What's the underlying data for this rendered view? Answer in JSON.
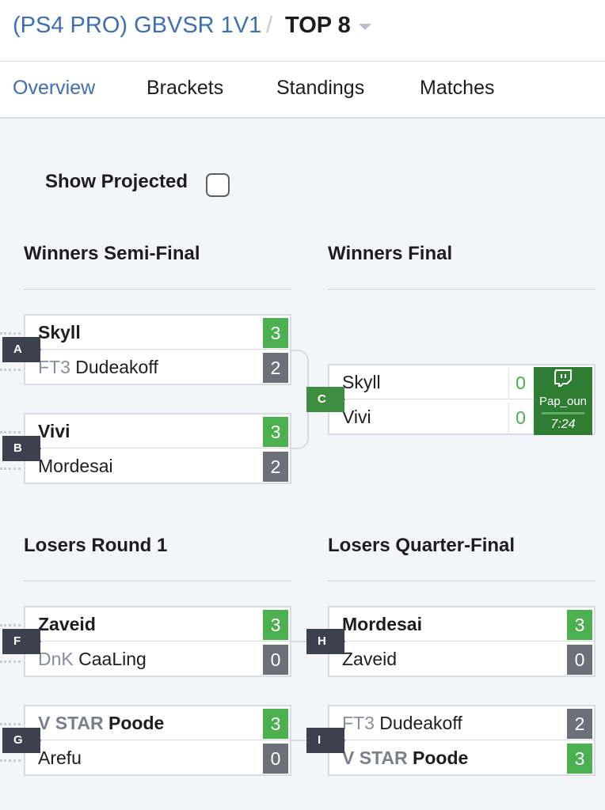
{
  "header": {
    "event": "(PS4 PRO) GBVSR 1V1",
    "separator": "/",
    "phase": "TOP 8"
  },
  "tabs": [
    {
      "label": "Overview",
      "active": true
    },
    {
      "label": "Brackets",
      "active": false
    },
    {
      "label": "Standings",
      "active": false
    },
    {
      "label": "Matches",
      "active": false
    }
  ],
  "show_projected": {
    "label": "Show Projected",
    "checked": false
  },
  "rounds": {
    "winners_semi": "Winners Semi-Final",
    "winners_final": "Winners Final",
    "losers_r1": "Losers Round 1",
    "losers_qf": "Losers Quarter-Final"
  },
  "matches": {
    "A": {
      "id": "A",
      "p1": {
        "prefix": "",
        "name": "Skyll",
        "score": "3",
        "win": true
      },
      "p2": {
        "prefix": "FT3",
        "name": "Dudeakoff",
        "score": "2",
        "win": false
      }
    },
    "B": {
      "id": "B",
      "p1": {
        "prefix": "",
        "name": "Vivi",
        "score": "3",
        "win": true
      },
      "p2": {
        "prefix": "",
        "name": "Mordesai",
        "score": "2",
        "win": false
      }
    },
    "C": {
      "id": "C",
      "p1": {
        "prefix": "",
        "name": "Skyll",
        "score": "0"
      },
      "p2": {
        "prefix": "",
        "name": "Vivi",
        "score": "0"
      },
      "stream": {
        "channel": "Pap_oun",
        "time": "7:24"
      }
    },
    "F": {
      "id": "F",
      "p1": {
        "prefix": "",
        "name": "Zaveid",
        "score": "3",
        "win": true
      },
      "p2": {
        "prefix": "DnK",
        "name": "CaaLing",
        "score": "0",
        "win": false
      }
    },
    "G": {
      "id": "G",
      "p1": {
        "prefix": "V STAR",
        "name": "Poode",
        "score": "3",
        "win": true
      },
      "p2": {
        "prefix": "",
        "name": "Arefu",
        "score": "0",
        "win": false
      }
    },
    "H": {
      "id": "H",
      "p1": {
        "prefix": "",
        "name": "Mordesai",
        "score": "3",
        "win": true
      },
      "p2": {
        "prefix": "",
        "name": "Zaveid",
        "score": "0",
        "win": false
      }
    },
    "I": {
      "id": "I",
      "p1": {
        "prefix": "FT3",
        "name": "Dudeakoff",
        "score": "2",
        "win": false
      },
      "p2": {
        "prefix": "V STAR",
        "name": "Poode",
        "score": "3",
        "win": true
      }
    }
  },
  "colors": {
    "accent": "#3f6fb0",
    "win": "#4caf50",
    "lose": "#6b7079",
    "live": "#2e7d32",
    "flag": "#3b424e"
  }
}
